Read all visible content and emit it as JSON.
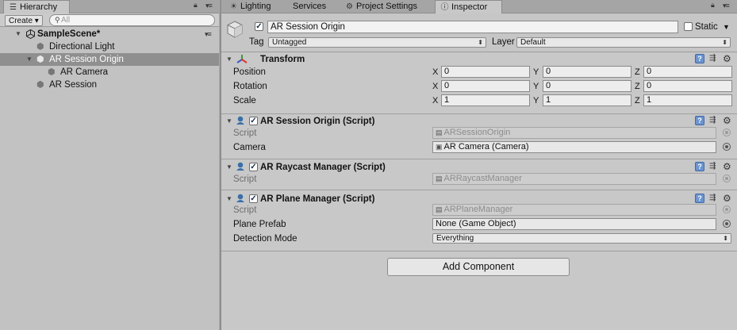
{
  "hierarchy": {
    "tab_label": "Hierarchy",
    "create_label": "Create",
    "search_placeholder": "All",
    "scene_name": "SampleScene*",
    "items": [
      {
        "label": "Directional Light"
      },
      {
        "label": "AR Session Origin"
      },
      {
        "label": "AR Camera"
      },
      {
        "label": "AR Session"
      }
    ]
  },
  "inspector": {
    "tabs": [
      {
        "label": "Lighting"
      },
      {
        "label": "Services"
      },
      {
        "label": "Project Settings"
      },
      {
        "label": "Inspector"
      }
    ],
    "object_name": "AR Session Origin",
    "static_label": "Static",
    "tag_label": "Tag",
    "tag_value": "Untagged",
    "layer_label": "Layer",
    "layer_value": "Default",
    "transform": {
      "title": "Transform",
      "axes": [
        "X",
        "Y",
        "Z"
      ],
      "rows": [
        {
          "label": "Position",
          "values": [
            "0",
            "0",
            "0"
          ]
        },
        {
          "label": "Rotation",
          "values": [
            "0",
            "0",
            "0"
          ]
        },
        {
          "label": "Scale",
          "values": [
            "1",
            "1",
            "1"
          ]
        }
      ]
    },
    "components": [
      {
        "title": "AR Session Origin (Script)",
        "script_label": "Script",
        "script_value": "ARSessionOrigin",
        "field_label": "Camera",
        "field_value": "AR Camera (Camera)"
      },
      {
        "title": "AR Raycast Manager (Script)",
        "script_label": "Script",
        "script_value": "ARRaycastManager"
      },
      {
        "title": "AR Plane Manager (Script)",
        "script_label": "Script",
        "script_value": "ARPlaneManager",
        "prefab_label": "Plane Prefab",
        "prefab_value": "None (Game Object)",
        "mode_label": "Detection Mode",
        "mode_value": "Everything"
      }
    ],
    "add_component_label": "Add Component"
  },
  "colors": {
    "selected_row": "#8f8f8f",
    "help_blue": "#6c95d0",
    "panel_bg": "#c8c8c8"
  }
}
